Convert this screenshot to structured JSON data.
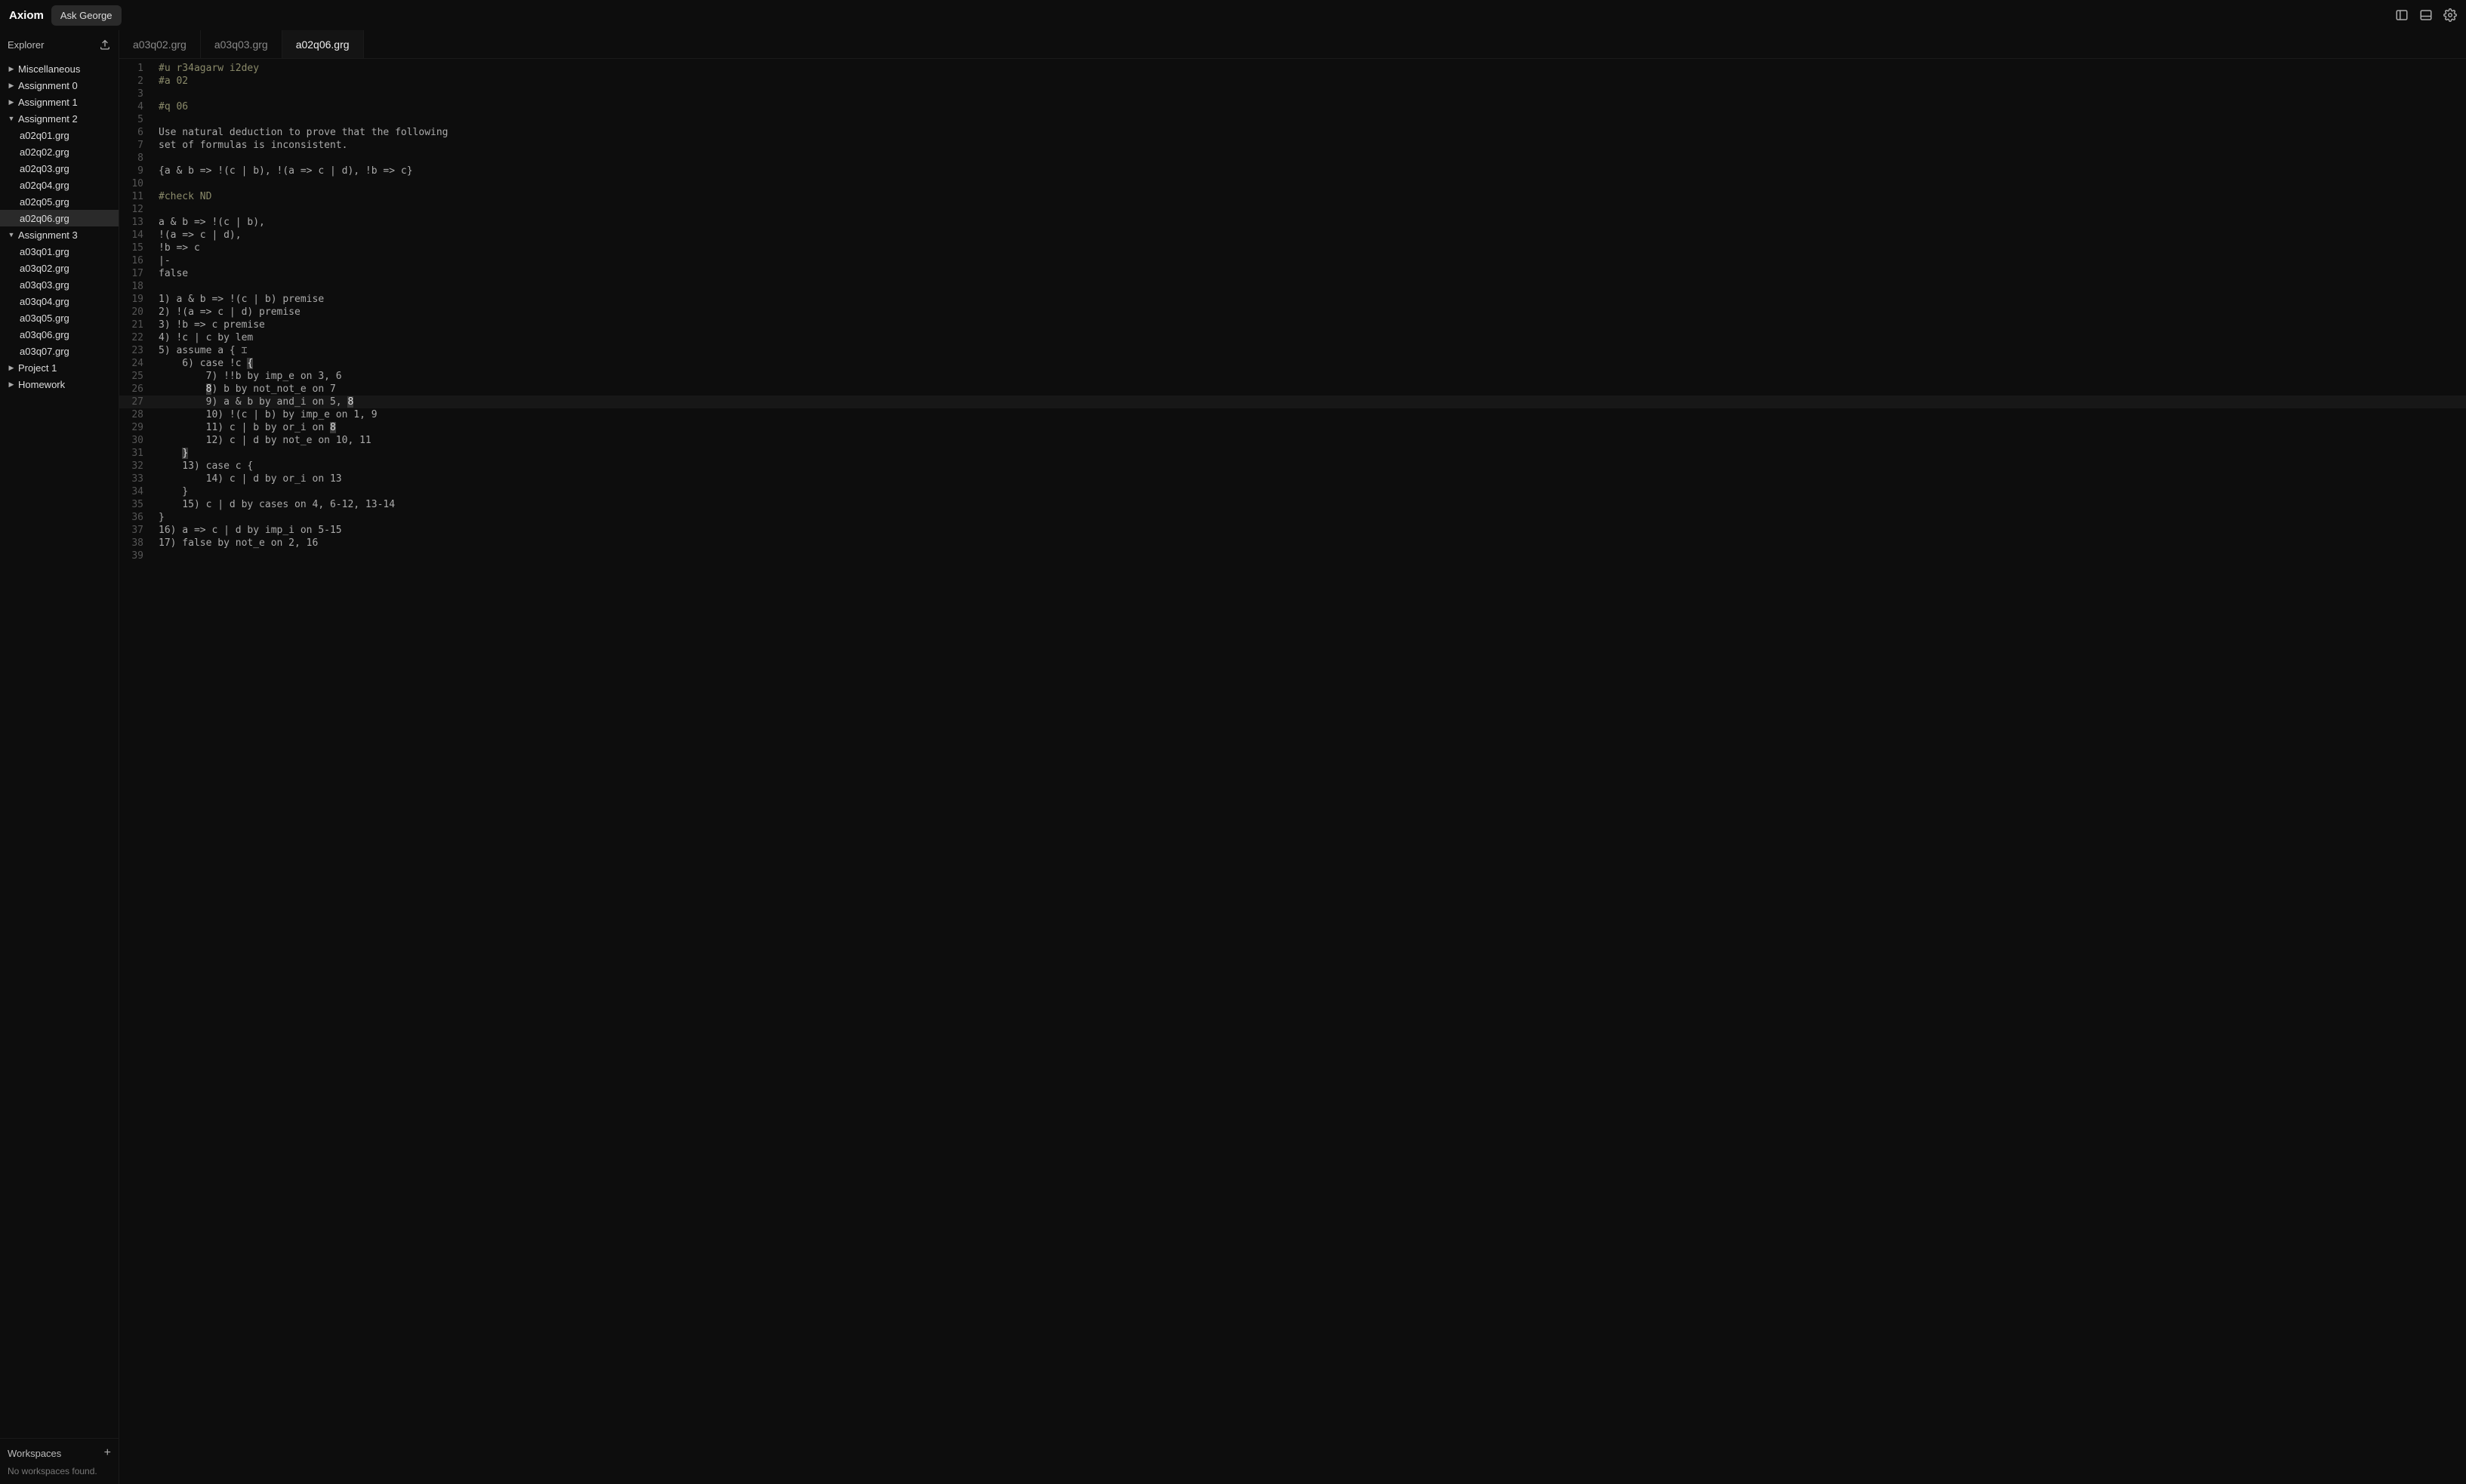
{
  "app": {
    "title": "Axiom",
    "ask_button": "Ask George"
  },
  "sidebar": {
    "title": "Explorer",
    "tree": [
      {
        "label": "Miscellaneous",
        "expanded": false,
        "children": []
      },
      {
        "label": "Assignment 0",
        "expanded": false,
        "children": []
      },
      {
        "label": "Assignment 1",
        "expanded": false,
        "children": []
      },
      {
        "label": "Assignment 2",
        "expanded": true,
        "children": [
          "a02q01.grg",
          "a02q02.grg",
          "a02q03.grg",
          "a02q04.grg",
          "a02q05.grg",
          "a02q06.grg"
        ]
      },
      {
        "label": "Assignment 3",
        "expanded": true,
        "children": [
          "a03q01.grg",
          "a03q02.grg",
          "a03q03.grg",
          "a03q04.grg",
          "a03q05.grg",
          "a03q06.grg",
          "a03q07.grg"
        ]
      },
      {
        "label": "Project 1",
        "expanded": false,
        "children": []
      },
      {
        "label": "Homework",
        "expanded": false,
        "children": []
      }
    ],
    "active_file": "a02q06.grg"
  },
  "workspaces": {
    "title": "Workspaces",
    "empty": "No workspaces found."
  },
  "tabs": [
    {
      "label": "a03q02.grg",
      "active": false
    },
    {
      "label": "a03q03.grg",
      "active": false
    },
    {
      "label": "a02q06.grg",
      "active": true
    }
  ],
  "editor": {
    "current_line": 27,
    "lines": [
      "#u r34agarw i2dey",
      "#a 02",
      "",
      "#q 06",
      "",
      "Use natural deduction to prove that the following",
      "set of formulas is inconsistent.",
      "",
      "{a & b => !(c | b), !(a => c | d), !b => c}",
      "",
      "#check ND",
      "",
      "a & b => !(c | b),",
      "!(a => c | d),",
      "!b => c",
      "|-",
      "false",
      "",
      "1) a & b => !(c | b) premise",
      "2) !(a => c | d) premise",
      "3) !b => c premise",
      "4) !c | c by lem",
      "5) assume a {",
      "    6) case !c {",
      "        7) !!b by imp_e on 3, 6",
      "        8) b by not_not_e on 7",
      "        9) a & b by and_i on 5, 8",
      "        10) !(c | b) by imp_e on 1, 9",
      "        11) c | b by or_i on 8",
      "        12) c | d by not_e on 10, 11",
      "    }",
      "    13) case c {",
      "        14) c | d by or_i on 13",
      "    }",
      "    15) c | d by cases on 4, 6-12, 13-14",
      "}",
      "16) a => c | d by imp_i on 5-15",
      "17) false by not_e on 2, 16",
      ""
    ]
  }
}
